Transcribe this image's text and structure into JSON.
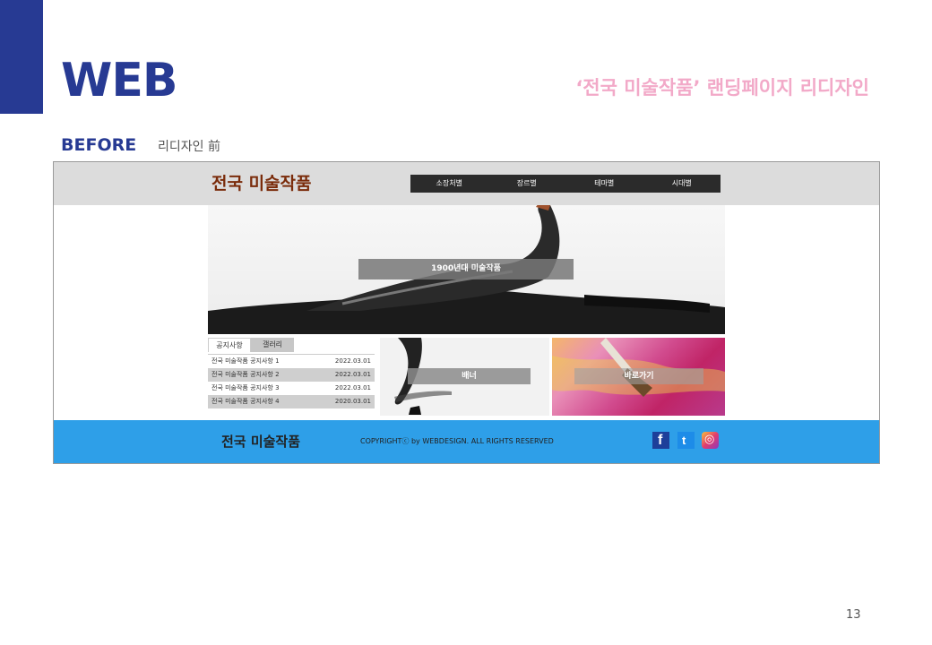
{
  "slide": {
    "title": "WEB",
    "project_title": "‘전국 미술작품’ 랜딩페이지 리디자인",
    "before_label": "BEFORE",
    "before_sub": "리디자인 前",
    "page_number": "13",
    "accent_color": "#273a93",
    "pink_color": "#f2a9c8"
  },
  "mockup": {
    "logo": "전국 미술작품",
    "nav": [
      "소장처별",
      "장르별",
      "테마별",
      "시대별"
    ],
    "hero_button": "1900년대 미술작품",
    "tabs": [
      "공지사항",
      "갤러리"
    ],
    "notices": [
      {
        "title": "전국 미술작품 공지사항 1",
        "date": "2022.03.01"
      },
      {
        "title": "전국 미술작품 공지사항 2",
        "date": "2022.03.01"
      },
      {
        "title": "전국 미술작품 공지사항 3",
        "date": "2022.03.01"
      },
      {
        "title": "전국 미술작품 공지사항 4",
        "date": "2020.03.01"
      }
    ],
    "banner_button": "배너",
    "shortcut_button": "바로가기",
    "footer": {
      "logo": "전국 미술작품",
      "copyright": "COPYRIGHTⓒ by WEBDESIGN. ALL RIGHTS RESERVED",
      "sns": [
        {
          "name": "facebook",
          "glyph": "f"
        },
        {
          "name": "twitter",
          "glyph": "t"
        },
        {
          "name": "instagram",
          "glyph": "◎"
        }
      ]
    },
    "header_color": "#dcdcdc",
    "footer_color": "#2e9fe8",
    "logo_color": "#7a2b0a"
  }
}
